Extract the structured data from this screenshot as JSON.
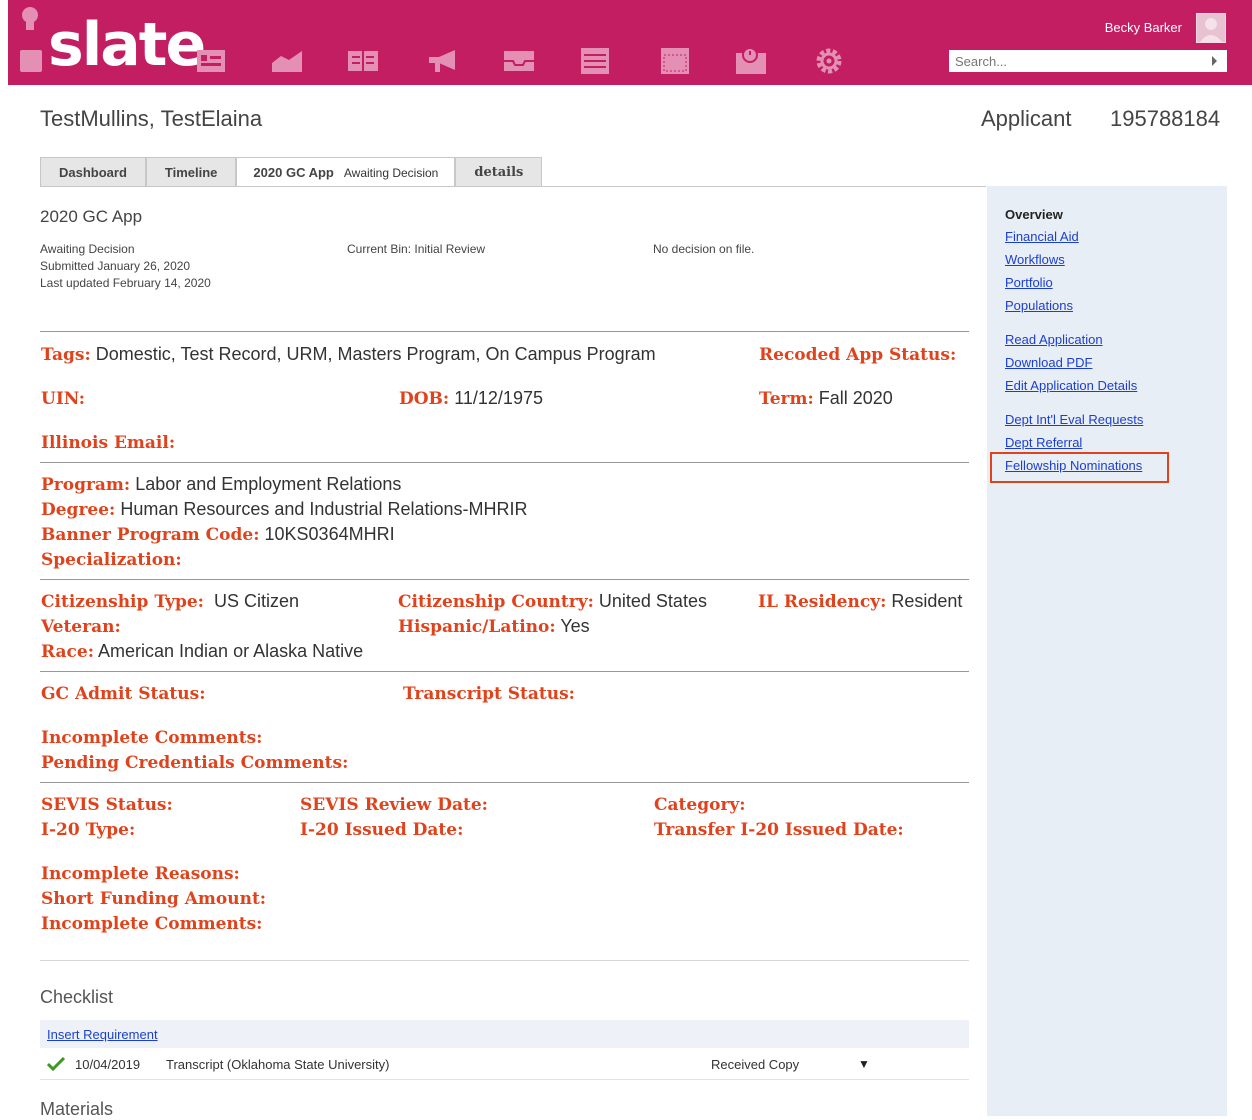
{
  "header": {
    "logo_text": "slate",
    "user_name": "Becky Barker",
    "search_placeholder": "Search...",
    "brand_color": "#c41e63",
    "nav_icons": [
      "person-card-icon",
      "chart-icon",
      "book-icon",
      "megaphone-icon",
      "inbox-icon",
      "list-icon",
      "calendar-icon",
      "schedule-icon",
      "gear-icon"
    ]
  },
  "person": {
    "name": "TestMullins, TestElaina",
    "type": "Applicant",
    "id": "195788184"
  },
  "tabs": [
    {
      "label": "Dashboard"
    },
    {
      "label": "Timeline"
    },
    {
      "label": "2020 GC App",
      "sub": "Awaiting Decision",
      "active": true
    },
    {
      "label": "details"
    }
  ],
  "app": {
    "title": "2020 GC App",
    "status": "Awaiting Decision",
    "submitted": "Submitted January 26, 2020",
    "updated": "Last updated February 14, 2020",
    "current_bin": "Current Bin: Initial Review",
    "decision": "No decision on file."
  },
  "fields": {
    "tags_label": "Tags:",
    "tags_value": "Domestic, Test Record, URM, Masters Program, On Campus Program",
    "recoded_label": "Recoded App Status:",
    "uin_label": "UIN:",
    "dob_label": "DOB:",
    "dob_value": "11/12/1975",
    "term_label": "Term:",
    "term_value": "Fall 2020",
    "email_label": "Illinois Email:",
    "program_label": "Program:",
    "program_value": "Labor and Employment Relations",
    "degree_label": "Degree:",
    "degree_value": "Human Resources and Industrial Relations-MHRIR",
    "banner_label": "Banner Program Code:",
    "banner_value": "10KS0364MHRI",
    "specialization_label": "Specialization:",
    "cit_type_label": "Citizenship Type:",
    "cit_type_value": "US Citizen",
    "cit_country_label": "Citizenship Country:",
    "cit_country_value": "United States",
    "residency_label": "IL Residency:",
    "residency_value": "Resident",
    "veteran_label": "Veteran:",
    "hispanic_label": "Hispanic/Latino:",
    "hispanic_value": "Yes",
    "race_label": "Race:",
    "race_value": "American Indian or Alaska Native",
    "gc_admit_label": "GC Admit Status:",
    "transcript_label": "Transcript Status:",
    "incomplete_comments_label": "Incomplete Comments:",
    "pending_label": "Pending Credentials Comments:",
    "sevis_status_label": "SEVIS Status:",
    "sevis_review_label": "SEVIS Review Date:",
    "category_label": "Category:",
    "i20_type_label": "I-20 Type:",
    "i20_issued_label": "I-20 Issued Date:",
    "transfer_label": "Transfer I-20 Issued Date:",
    "incomplete_reasons_label": "Incomplete Reasons:",
    "short_funding_label": "Short Funding Amount:",
    "incomplete_comments2_label": "Incomplete Comments:"
  },
  "checklist": {
    "title": "Checklist",
    "insert_link": "Insert Requirement",
    "rows": [
      {
        "date": "10/04/2019",
        "item": "Transcript (Oklahoma State University)",
        "status": "Received Copy"
      }
    ]
  },
  "materials_title": "Materials",
  "sidebar": {
    "heading": "Overview",
    "group1": [
      "Financial Aid",
      "Workflows",
      "Portfolio",
      "Populations"
    ],
    "group2": [
      "Read Application",
      "Download PDF",
      "Edit Application Details"
    ],
    "group3": [
      "Dept Int'l Eval Requests",
      "Dept Referral",
      "Fellowship Nominations"
    ]
  }
}
